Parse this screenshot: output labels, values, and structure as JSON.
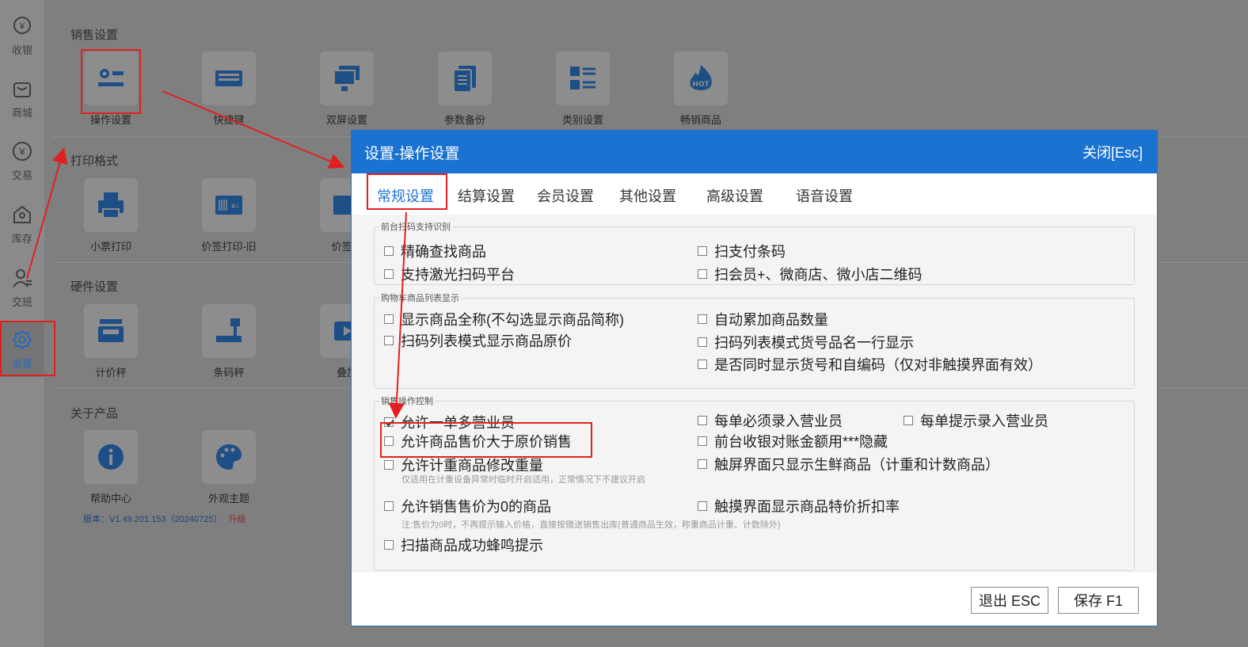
{
  "sidebar": {
    "items": [
      {
        "label": "收银",
        "icon": "yen-coin-icon"
      },
      {
        "label": "商城",
        "icon": "shop-icon"
      },
      {
        "label": "交易",
        "icon": "yen-circle-icon"
      },
      {
        "label": "库存",
        "icon": "warehouse-icon"
      },
      {
        "label": "交班",
        "icon": "user-shift-icon"
      },
      {
        "label": "设置",
        "icon": "gear-icon",
        "active": true
      }
    ]
  },
  "sections": {
    "sales": {
      "title": "销售设置",
      "tiles": [
        {
          "label": "操作设置",
          "icon": "operation-settings-icon"
        },
        {
          "label": "快捷键",
          "icon": "keyboard-icon"
        },
        {
          "label": "双屏设置",
          "icon": "dual-screen-icon"
        },
        {
          "label": "参数备份",
          "icon": "document-backup-icon"
        },
        {
          "label": "类别设置",
          "icon": "category-list-icon"
        },
        {
          "label": "畅销商品",
          "icon": "hot-icon"
        }
      ]
    },
    "print": {
      "title": "打印格式",
      "tiles": [
        {
          "label": "小票打印",
          "icon": "printer-icon"
        },
        {
          "label": "价签打印-旧",
          "icon": "price-tag-icon"
        },
        {
          "label": "价签打",
          "icon": "barcode-icon"
        }
      ]
    },
    "hardware": {
      "title": "硬件设置",
      "tiles": [
        {
          "label": "计价秤",
          "icon": "price-scale-icon"
        },
        {
          "label": "条码秤",
          "icon": "barcode-scale-icon"
        },
        {
          "label": "叠加",
          "icon": "video-icon"
        }
      ]
    },
    "about": {
      "title": "关于产品",
      "tiles": [
        {
          "label": "帮助中心",
          "icon": "info-icon"
        },
        {
          "label": "外观主题",
          "icon": "palette-icon"
        }
      ]
    }
  },
  "version": {
    "text": "版本：V1.49.201.153（20240725）",
    "upgrade": "升级"
  },
  "dialog": {
    "title": "设置-操作设置",
    "close": "关闭[Esc]",
    "tabs": [
      "常规设置",
      "结算设置",
      "会员设置",
      "其他设置",
      "高级设置",
      "语音设置"
    ],
    "active_tab": "常规设置",
    "groups": {
      "scan": {
        "title": "前台扫码支持识别",
        "options": [
          {
            "label": "精确查找商品",
            "checked": false
          },
          {
            "label": "扫支付条码",
            "checked": false
          },
          {
            "label": "支持激光扫码平台",
            "checked": false
          },
          {
            "label": "扫会员+、微商店、微小店二维码",
            "checked": false
          }
        ]
      },
      "cart": {
        "title": "购物车商品列表显示",
        "options": [
          {
            "label": "显示商品全称(不勾选显示商品简称)",
            "checked": false
          },
          {
            "label": "自动累加商品数量",
            "checked": false
          },
          {
            "label": "扫码列表模式显示商品原价",
            "checked": false
          },
          {
            "label": "扫码列表模式货号品名一行显示",
            "checked": false
          },
          {
            "label": "是否同时显示货号和自编码（仅对非触摸界面有效）",
            "checked": false
          }
        ]
      },
      "sales": {
        "title": "销售操作控制",
        "options": [
          {
            "label": "允许一单多营业员",
            "checked": true
          },
          {
            "label": "每单必须录入营业员",
            "checked": false
          },
          {
            "label": "每单提示录入营业员",
            "checked": false
          },
          {
            "label": "允许商品售价大于原价销售",
            "checked": false
          },
          {
            "label": "前台收银对账金额用***隐藏",
            "checked": false
          },
          {
            "label": "允许计重商品修改重量",
            "checked": false
          },
          {
            "label": "触屏界面只显示生鲜商品（计重和计数商品）",
            "checked": false
          },
          {
            "label": "允许销售售价为0的商品",
            "checked": false
          },
          {
            "label": "触摸界面显示商品特价折扣率",
            "checked": false
          },
          {
            "label": "扫描商品成功蜂鸣提示",
            "checked": false
          }
        ],
        "notes": {
          "weight": "仅适用在计重设备异常时临时开启适用，正常情况下不建议开启",
          "zero_price": "注:售价为0时，不再提示输入价格，直接按赠送销售出库(普通商品生效，称重商品计重、计数除外)"
        }
      }
    },
    "buttons": {
      "exit": "退出 ESC",
      "save": "保存 F1"
    }
  },
  "colors": {
    "accent": "#1b73d1",
    "highlight": "#e02020",
    "overlay": "#7f7f7f"
  }
}
